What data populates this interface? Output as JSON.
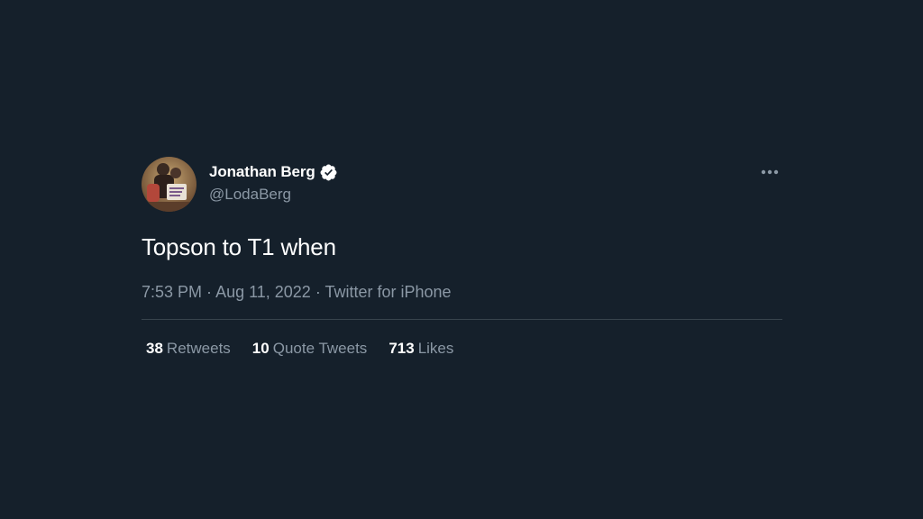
{
  "tweet": {
    "author": {
      "display_name": "Jonathan Berg",
      "handle": "@LodaBerg",
      "verified": true
    },
    "text": "Topson to T1 when",
    "meta": {
      "time": "7:53 PM",
      "separator1": " · ",
      "date": "Aug 11, 2022",
      "separator2": " · ",
      "source": "Twitter for iPhone"
    },
    "stats": [
      {
        "count": "38",
        "label": "Retweets"
      },
      {
        "count": "10",
        "label": "Quote Tweets"
      },
      {
        "count": "713",
        "label": "Likes"
      }
    ]
  },
  "colors": {
    "background": "#15202b",
    "primary_text": "#ffffff",
    "secondary_text": "#8b98a5",
    "divider": "#38444d",
    "verified_badge": "#ffffff"
  },
  "icons": {
    "verified": "verified-badge-icon",
    "more": "more-horizontal-icon"
  }
}
